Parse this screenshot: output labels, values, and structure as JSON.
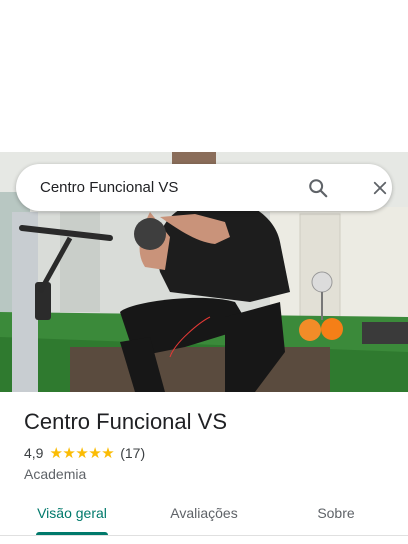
{
  "search": {
    "query": "Centro Funcional VS",
    "search_icon": "search-icon",
    "close_icon": "close-icon"
  },
  "place": {
    "name": "Centro Funcional VS",
    "rating": "4,9",
    "stars": 5,
    "review_count": "(17)",
    "category": "Academia"
  },
  "tabs": [
    {
      "label": "Visão geral",
      "active": true
    },
    {
      "label": "Avaliações",
      "active": false
    },
    {
      "label": "Sobre",
      "active": false
    }
  ],
  "colors": {
    "accent": "#00796b",
    "star": "#fbbc04",
    "text": "#202124",
    "secondary": "#5f6368"
  }
}
